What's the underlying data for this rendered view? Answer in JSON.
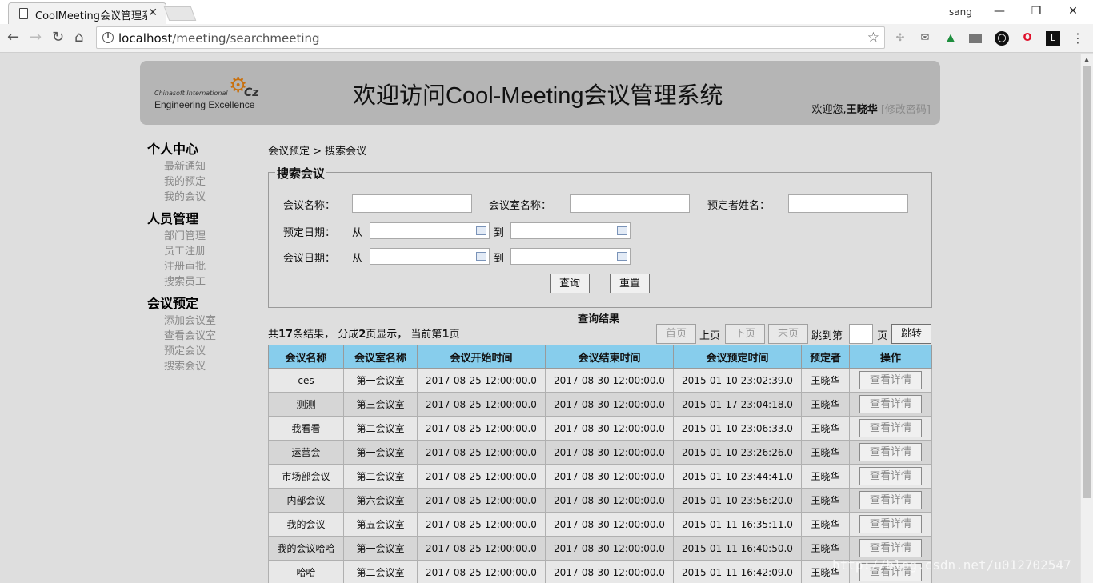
{
  "browser": {
    "tab_title": "CoolMeeting会议管理系",
    "window_user": "sang",
    "url_host": "localhost",
    "url_path": "/meeting/searchmeeting",
    "minimize": "—",
    "restore": "❐",
    "close": "✕"
  },
  "header": {
    "logo_line1": "Chinasoft International",
    "logo_line2": "Engineering Excellence",
    "title": "欢迎访问Cool-Meeting会议管理系统",
    "welcome_prefix": "欢迎您,",
    "username": "王晓华",
    "change_password": "[修改密码]"
  },
  "sidebar": [
    {
      "title": "个人中心",
      "items": [
        "最新通知",
        "我的预定",
        "我的会议"
      ]
    },
    {
      "title": "人员管理",
      "items": [
        "部门管理",
        "员工注册",
        "注册审批",
        "搜索员工"
      ]
    },
    {
      "title": "会议预定",
      "items": [
        "添加会议室",
        "查看会议室",
        "预定会议",
        "搜索会议"
      ]
    }
  ],
  "breadcrumb": "会议预定 > 搜索会议",
  "search": {
    "legend": "搜索会议",
    "meeting_name_label": "会议名称：",
    "room_name_label": "会议室名称：",
    "reserver_label": "预定者姓名：",
    "reserve_date_label": "预定日期：",
    "meeting_date_label": "会议日期：",
    "from": "从",
    "to": "到",
    "query_button": "查询",
    "reset_button": "重置"
  },
  "results": {
    "title": "查询结果",
    "summary_prefix": "共",
    "total": "17",
    "summary_mid": "条结果， 分成",
    "pages": "2",
    "summary_mid2": "页显示， 当前第",
    "current": "1",
    "summary_end": "页",
    "first": "首页",
    "prev": "上页",
    "next": "下页",
    "last": "末页",
    "jump_prefix": "跳到第",
    "jump_suffix": "页",
    "jump_button": "跳转"
  },
  "table": {
    "headers": [
      "会议名称",
      "会议室名称",
      "会议开始时间",
      "会议结束时间",
      "会议预定时间",
      "预定者",
      "操作"
    ],
    "detail_label": "查看详情",
    "rows": [
      [
        "ces",
        "第一会议室",
        "2017-08-25 12:00:00.0",
        "2017-08-30 12:00:00.0",
        "2015-01-10 23:02:39.0",
        "王晓华"
      ],
      [
        "测测",
        "第三会议室",
        "2017-08-25 12:00:00.0",
        "2017-08-30 12:00:00.0",
        "2015-01-17 23:04:18.0",
        "王晓华"
      ],
      [
        "我看看",
        "第二会议室",
        "2017-08-25 12:00:00.0",
        "2017-08-30 12:00:00.0",
        "2015-01-10 23:06:33.0",
        "王晓华"
      ],
      [
        "运营会",
        "第一会议室",
        "2017-08-25 12:00:00.0",
        "2017-08-30 12:00:00.0",
        "2015-01-10 23:26:26.0",
        "王晓华"
      ],
      [
        "市场部会议",
        "第二会议室",
        "2017-08-25 12:00:00.0",
        "2017-08-30 12:00:00.0",
        "2015-01-10 23:44:41.0",
        "王晓华"
      ],
      [
        "内部会议",
        "第六会议室",
        "2017-08-25 12:00:00.0",
        "2017-08-30 12:00:00.0",
        "2015-01-10 23:56:20.0",
        "王晓华"
      ],
      [
        "我的会议",
        "第五会议室",
        "2017-08-25 12:00:00.0",
        "2017-08-30 12:00:00.0",
        "2015-01-11 16:35:11.0",
        "王晓华"
      ],
      [
        "我的会议哈哈",
        "第一会议室",
        "2017-08-25 12:00:00.0",
        "2017-08-30 12:00:00.0",
        "2015-01-11 16:40:50.0",
        "王晓华"
      ],
      [
        "哈哈",
        "第二会议室",
        "2017-08-25 12:00:00.0",
        "2017-08-30 12:00:00.0",
        "2015-01-11 16:42:09.0",
        "王晓华"
      ]
    ]
  },
  "watermark": "http://blog.csdn.net/u012702547"
}
